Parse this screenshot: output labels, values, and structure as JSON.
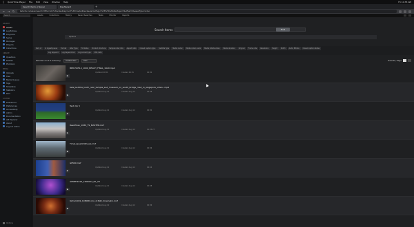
{
  "menubar": {
    "apple": "",
    "app": "QuickTime Player",
    "items": [
      "File",
      "Edit",
      "View",
      "Window",
      "Help"
    ],
    "clock": "Fri 10:33 AM"
  },
  "browser": {
    "tabs": [
      "Search Items | Slaver",
      "Dashboard"
    ],
    "url": "beta.tbc.ca/slaver/search?dfilter=sfx%3Avideo&tag=sort%3DCreatedDesc&selectedTags=%5B%5D&hitsPerPage=5&offset=0&assetType=video"
  },
  "appbar": {
    "search_placeholder": "Search",
    "nav": [
      "Assets",
      "Collections",
      "History",
      "Saved Searches",
      "Tasks",
      "Monitor",
      "Reports"
    ]
  },
  "sidebar": {
    "sections": [
      {
        "title": "Search",
        "items": [
          "Assets",
          "Log Entries",
          "Programs",
          "Series",
          "Packages",
          "Projects",
          "Collections"
        ]
      },
      {
        "title": "Create",
        "items": [
          "Questions",
          "Profiles",
          "Photobox"
        ]
      },
      {
        "title": "Media",
        "items": [
          "Uploads",
          "Files",
          "Media Queues",
          "Tags",
          "Templates",
          "Statistics",
          "Rem"
        ]
      },
      {
        "title": "System",
        "items": [
          "Dashboard",
          "Preferences",
          "Accessibility",
          "Admin",
          "Documentation",
          "API Explorer",
          "About",
          "Log out Admin"
        ]
      }
    ],
    "active": "Assets",
    "footer": "Options"
  },
  "main": {
    "search_title": "Search Items",
    "search_value": "",
    "find_label": "Find",
    "options_label": "Options",
    "filter_chips_row1": [
      "Item id",
      "In Ingest queue",
      "Format",
      "Alter Type",
      "TV status",
      "Product structure",
      "Sample rate / bits",
      "Aspect ratio",
      "Closed caption type",
      "Subtitle Type",
      "Media codec",
      "Media codec audio",
      "Media bitrate video",
      "Media duration",
      "Original",
      "Frame rate",
      "Resolution",
      "Height",
      "Width",
      "Audio Bitrate",
      "Closed caption status"
    ],
    "filter_chips_row2": [
      "Log Keyword",
      "Log Keyword list",
      "Log Linked type",
      "XML data"
    ],
    "results_text": "Results 1-8 of 8 sorted by",
    "sort_value": "Created desc",
    "sort_dir": "Desc",
    "per_page_label": "Results / Page",
    "pages": [
      "1",
      "2"
    ]
  },
  "rows": [
    {
      "name": "BPD150514_1000_BEACH_FINAL_1920.mp4",
      "updated": "Updated  09:51",
      "created": "Created  09:51",
      "dur": "00:30"
    },
    {
      "name": "tata_buddha_tooth_relic_temple_and_museum_on_south_bridge_road_in_singapore_video...mp4",
      "updated": "Updated  Aug 12",
      "created": "Created  Aug 12",
      "dur": "00:38"
    },
    {
      "name": "Test clip 5",
      "updated": "Updated  Aug 12",
      "created": "Created  Aug 12",
      "dur": "00:30"
    },
    {
      "name": "ReelVideo_1080_TS_MASTER.mxf",
      "updated": "Updated  Aug 12",
      "created": "Created  Aug 12",
      "dur": "01:25:27"
    },
    {
      "name": "TimeLapseOnWheels.mxf",
      "updated": "Updated  Aug 12",
      "created": "Created  Aug 12",
      "dur": "00:36"
    },
    {
      "name": "GF600.mxf",
      "updated": "Updated  Aug 12",
      "created": "Created  Aug 12",
      "dur": "00:24"
    },
    {
      "name": "GENPH2016_2306002_00_28",
      "updated": "Updated  Aug 12",
      "created": "Created  Aug 12",
      "dur": "00:28"
    },
    {
      "name": "62Cam001_1080i50.mx_2.3GB_Cinematic.mxf",
      "updated": "Updated  Aug 12",
      "created": "Created  Aug 12",
      "dur": "00:36"
    }
  ]
}
